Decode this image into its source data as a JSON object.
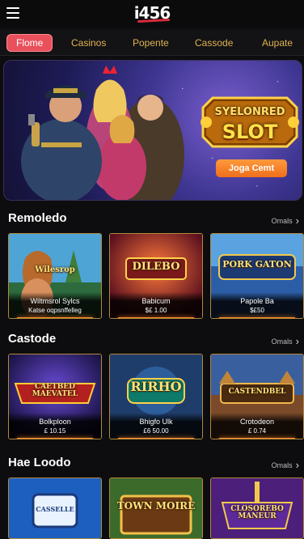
{
  "header": {
    "logo": "i456"
  },
  "nav": {
    "tabs": [
      "Flome",
      "Casinos",
      "Popente",
      "Cassode",
      "Aupate"
    ],
    "active": 0
  },
  "hero": {
    "slot_title_top": "SYELONRED",
    "slot_title_bottom": "SLOT",
    "button_label": "Joga Cemt"
  },
  "sections": [
    {
      "title": "Remoledo",
      "more": "Omals",
      "cards": [
        {
          "banner": "Wilesrop",
          "name": "Wiltmsrol Sylcs",
          "sub": "Katse oqpsnffelleg"
        },
        {
          "banner": "DILEBO",
          "name": "Babicum",
          "sub": "$£ 1.00"
        },
        {
          "banner": "PORK GATON",
          "name": "Papole Ba",
          "sub": "$£50"
        }
      ]
    },
    {
      "title": "Castode",
      "more": "Omals",
      "cards": [
        {
          "banner": "CAETBED MAEVATEL",
          "name": "Bolkploon",
          "sub": "£ 10.15"
        },
        {
          "banner": "RIRHO",
          "name": "Bhigfo Ulk",
          "sub": "£6 50.00"
        },
        {
          "banner": "CASTENDBEL",
          "name": "Crotodeon",
          "sub": "£ 0.74"
        }
      ]
    },
    {
      "title": "Hae Loodo",
      "more": "Omals",
      "cards": [
        {
          "banner": "CASSELLE",
          "name": "",
          "sub": ""
        },
        {
          "banner": "TOWN MOIRE",
          "name": "",
          "sub": ""
        },
        {
          "banner": "CLOSOREBO MANEUR",
          "name": "",
          "sub": ""
        }
      ]
    }
  ],
  "colors": {
    "accent": "#e8505b",
    "gold": "#e2b34e",
    "cta": "#ef6e1c",
    "background": "#0d0d0f"
  },
  "icons": [
    "menu-icon",
    "chevron-right-icon"
  ]
}
